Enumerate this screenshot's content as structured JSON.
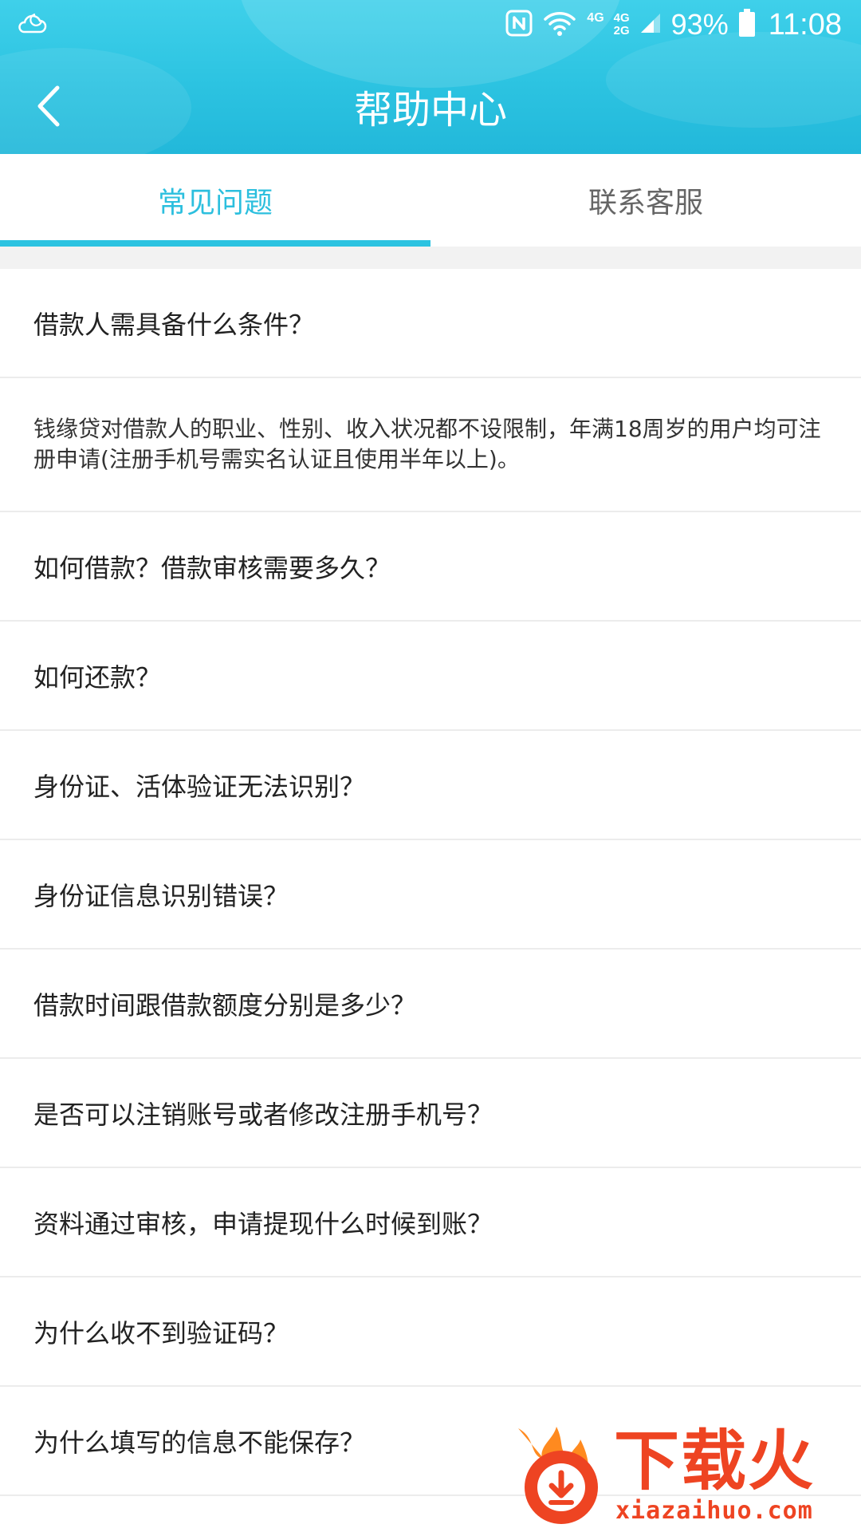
{
  "status_bar": {
    "weather_icon": "cloudy-night-icon",
    "nfc_icon": "nfc-icon",
    "wifi_icon": "wifi-icon",
    "network_1": "4G",
    "network_2_top": "4G",
    "network_2_bottom": "2G",
    "signal_icon": "signal-icon",
    "battery_percent": "93%",
    "battery_icon": "battery-icon",
    "time": "11:08"
  },
  "header": {
    "back_icon": "chevron-left-icon",
    "title": "帮助中心"
  },
  "tabs": [
    {
      "label": "常见问题",
      "active": true
    },
    {
      "label": "联系客服",
      "active": false
    }
  ],
  "faq": {
    "items": [
      {
        "question": "借款人需具备什么条件？"
      },
      {
        "answer": "钱缘贷对借款人的职业、性别、收入状况都不设限制，年满18周岁的用户均可注册申请(注册手机号需实名认证且使用半年以上)。"
      },
      {
        "question": "如何借款？借款审核需要多久？"
      },
      {
        "question": "如何还款？"
      },
      {
        "question": "身份证、活体验证无法识别？"
      },
      {
        "question": "身份证信息识别错误？"
      },
      {
        "question": "借款时间跟借款额度分别是多少？"
      },
      {
        "question": "是否可以注销账号或者修改注册手机号？"
      },
      {
        "question": "资料通过审核，申请提现什么时候到账？"
      },
      {
        "question": "为什么收不到验证码？"
      },
      {
        "question": "为什么填写的信息不能保存？"
      }
    ]
  },
  "watermark": {
    "logo_icon": "flame-download-logo-icon",
    "text": "下载火",
    "domain": "xiazaihuo.com"
  },
  "colors": {
    "header_bg": "#2cc3e1",
    "tab_active": "#2cbfde",
    "tab_inactive": "#666666",
    "watermark": "#ee4422"
  }
}
